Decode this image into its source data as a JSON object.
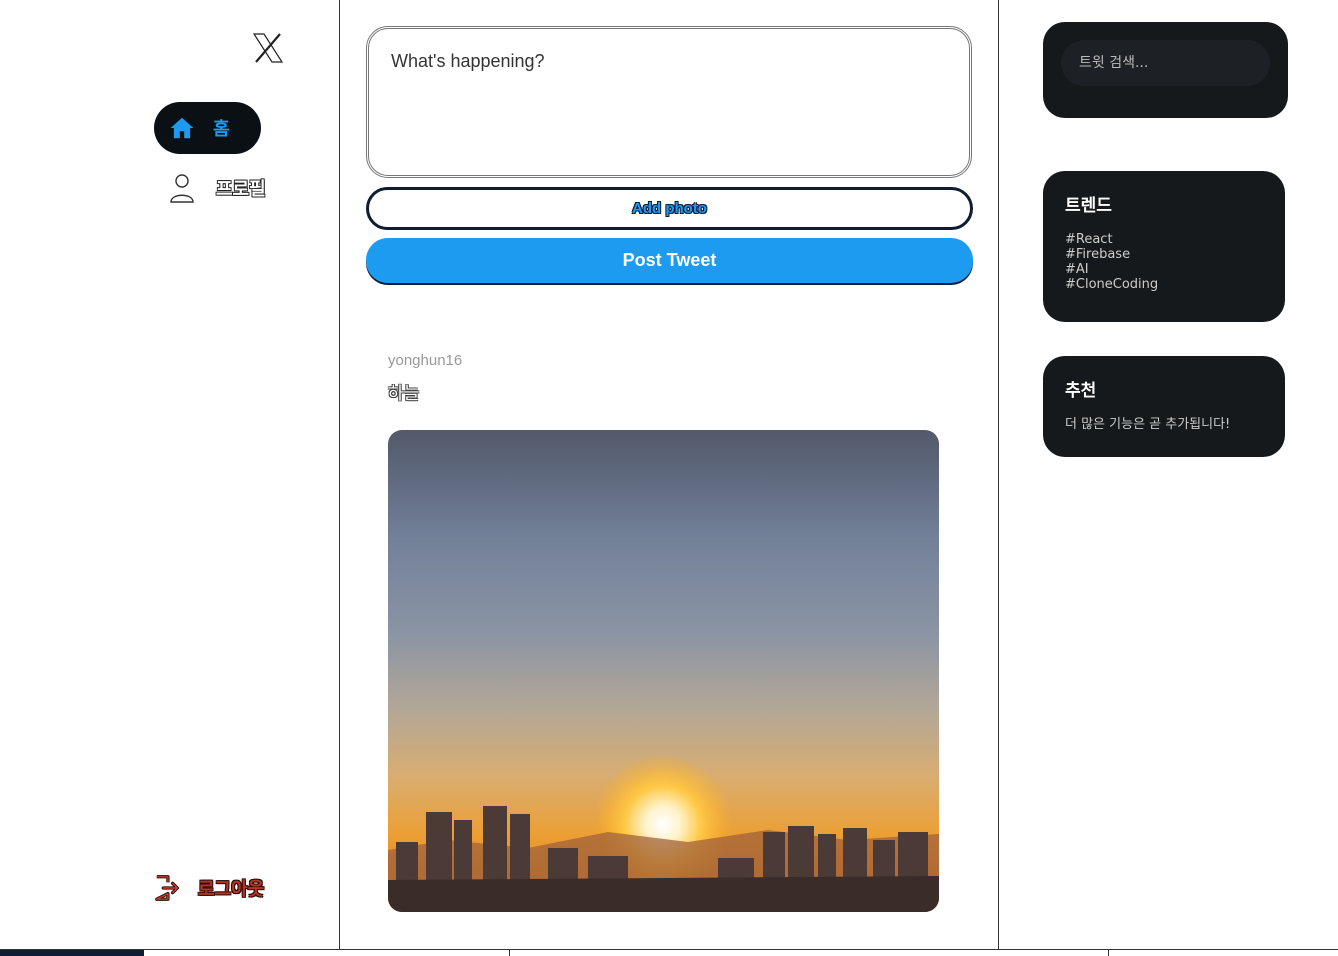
{
  "sidebar": {
    "logo_icon": "x-logo-icon",
    "items": [
      {
        "label": "홈",
        "icon": "home-icon",
        "active": true
      },
      {
        "label": "프로필",
        "icon": "user-icon",
        "active": false
      }
    ],
    "logout": {
      "label": "로그아웃",
      "icon": "logout-icon"
    }
  },
  "composer": {
    "placeholder": "What's happening?",
    "add_photo_label": "Add photo",
    "post_label": "Post Tweet"
  },
  "tweets": [
    {
      "username": "yonghun16",
      "text": "하늘",
      "image": "sunset-photo"
    }
  ],
  "right": {
    "search_placeholder": "트윗 검색...",
    "trends": {
      "title": "트렌드",
      "items": [
        "#React",
        "#Firebase",
        "#AI",
        "#CloneCoding"
      ]
    },
    "recommend": {
      "title": "추천",
      "text": "더 많은 기능은 곧 추가됩니다!"
    }
  },
  "colors": {
    "accent": "#1d9bf0",
    "card_bg": "#16191b",
    "logout_red": "#b43226"
  }
}
